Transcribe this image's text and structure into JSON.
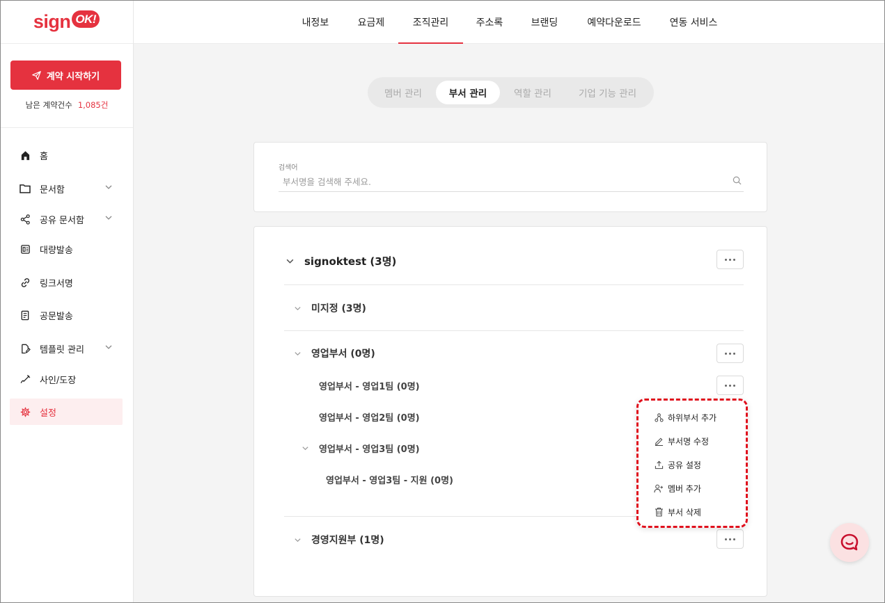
{
  "brand": {
    "logo_text": "sign",
    "logo_badge": "OK!"
  },
  "sidebar": {
    "start_button": "계약 시작하기",
    "remain_label": "남은 계약건수",
    "remain_count": "1,085건",
    "items": [
      {
        "label": "홈",
        "icon": "home-icon"
      },
      {
        "label": "문서함",
        "icon": "folder-icon"
      },
      {
        "label": "공유 문서함",
        "icon": "share-icon"
      },
      {
        "label": "대량발송",
        "icon": "bulk-send-icon"
      },
      {
        "label": "링크서명",
        "icon": "link-icon"
      },
      {
        "label": "공문발송",
        "icon": "document-icon"
      },
      {
        "label": "템플릿 관리",
        "icon": "template-icon"
      },
      {
        "label": "사인/도장",
        "icon": "signature-icon"
      },
      {
        "label": "설정",
        "icon": "gear-icon"
      }
    ]
  },
  "topnav": {
    "tabs": [
      "내정보",
      "요금제",
      "조직관리",
      "주소록",
      "브랜딩",
      "예약다운로드",
      "연동 서비스"
    ],
    "active": "조직관리"
  },
  "subtabs": {
    "items": [
      "멤버 관리",
      "부서 관리",
      "역할 관리",
      "기업 기능 관리"
    ],
    "active": "부서 관리"
  },
  "search": {
    "label": "검색어",
    "placeholder": "부서명을 검색해 주세요."
  },
  "tree": {
    "root": "signoktest (3명)",
    "unassigned": "미지정 (3명)",
    "sales": "영업부서 (0명)",
    "sales_team1": "영업부서 - 영업1팀 (0명)",
    "sales_team2": "영업부서 - 영업2팀 (0명)",
    "sales_team3": "영업부서 - 영업3팀 (0명)",
    "sales_team3_support": "영업부서 - 영업3팀 - 지원 (0명)",
    "management": "경영지원부 (1명)"
  },
  "dropdown": {
    "items": [
      {
        "label": "하위부서 추가",
        "icon": "sub-department-icon"
      },
      {
        "label": "부서명 수정",
        "icon": "edit-icon"
      },
      {
        "label": "공유 설정",
        "icon": "upload-share-icon"
      },
      {
        "label": "멤버 추가",
        "icon": "add-member-icon"
      },
      {
        "label": "부서 삭제",
        "icon": "trash-icon"
      }
    ]
  },
  "colors": {
    "accent": "#e5323f",
    "highlight_border": "#e0101d",
    "active_bg": "#fdeeef"
  }
}
